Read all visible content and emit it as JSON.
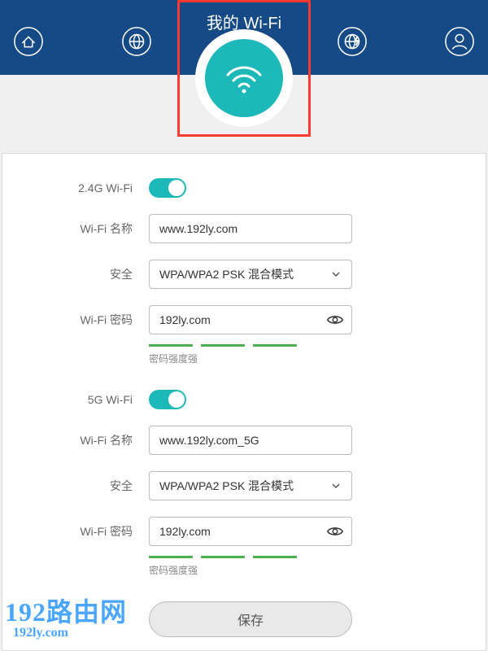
{
  "header": {
    "title": "我的 Wi-Fi"
  },
  "sections": {
    "g24": {
      "heading": "2.4G Wi-Fi",
      "name_label": "Wi-Fi 名称",
      "name_value": "www.192ly.com",
      "security_label": "安全",
      "security_value": "WPA/WPA2 PSK 混合模式",
      "password_label": "Wi-Fi 密码",
      "password_value": "192ly.com",
      "strength_text": "密码强度强"
    },
    "g5": {
      "heading": "5G Wi-Fi",
      "name_label": "Wi-Fi 名称",
      "name_value": "www.192ly.com_5G",
      "security_label": "安全",
      "security_value": "WPA/WPA2 PSK 混合模式",
      "password_label": "Wi-Fi 密码",
      "password_value": "192ly.com",
      "strength_text": "密码强度强"
    }
  },
  "buttons": {
    "save": "保存"
  },
  "watermark": {
    "line1": "192路由网",
    "line2": "192ly.com"
  }
}
